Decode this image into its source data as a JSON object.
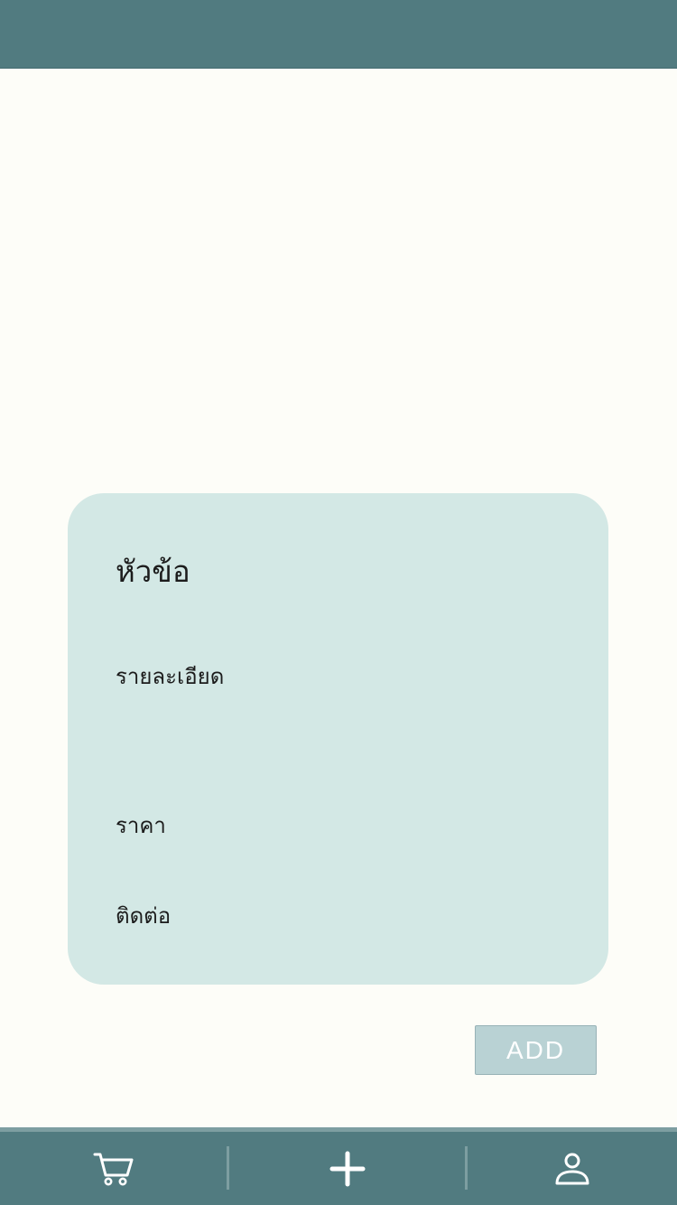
{
  "card": {
    "title_label": "หัวข้อ",
    "detail_label": "รายละเอียด",
    "price_label": "ราคา",
    "contact_label": "ติดต่อ"
  },
  "actions": {
    "add_label": "ADD"
  },
  "bottom_nav": {
    "items": [
      {
        "icon": "cart-icon"
      },
      {
        "icon": "plus-icon"
      },
      {
        "icon": "user-icon"
      }
    ]
  },
  "colors": {
    "header": "#517b80",
    "background": "#fdfdf8",
    "card": "#d3e8e5",
    "button": "#b9d2d4"
  }
}
